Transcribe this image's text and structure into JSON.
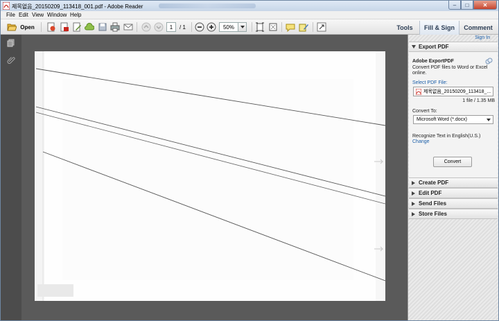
{
  "window": {
    "title": "제목없음_20150209_113418_001.pdf - Adobe Reader",
    "controls": {
      "minimize": "‒",
      "maximize": "□",
      "close": "✕"
    }
  },
  "menu": {
    "items": [
      "File",
      "Edit",
      "View",
      "Window",
      "Help"
    ]
  },
  "toolbar": {
    "open_label": "Open",
    "page_current": "1",
    "page_total": "/ 1",
    "zoom_value": "50%",
    "tabs": {
      "tools": "Tools",
      "fill_sign": "Fill & Sign",
      "comment": "Comment"
    }
  },
  "panel": {
    "sign_in": "Sign In",
    "export": {
      "header": "Export PDF",
      "service_title": "Adobe ExportPDF",
      "service_desc_1": "Convert PDF files to Word or Excel",
      "service_desc_2": "online.",
      "select_label": "Select PDF File:",
      "file_name": "제목없음_20150209_113418_...",
      "file_info": "1 file / 1.35 MB",
      "convert_to_label": "Convert To:",
      "format_value": "Microsoft Word (*.docx)",
      "recognize_text": "Recognize Text in English(U.S.)",
      "change_link": "Change",
      "convert_button": "Convert"
    },
    "sections": [
      "Create PDF",
      "Edit PDF",
      "Send Files",
      "Store Files"
    ]
  },
  "colors": {
    "link_blue": "#1b5ea8",
    "doc_background": "#5a5a5a",
    "left_rail": "#4c4c4c",
    "pdf_red": "#c8261d"
  }
}
